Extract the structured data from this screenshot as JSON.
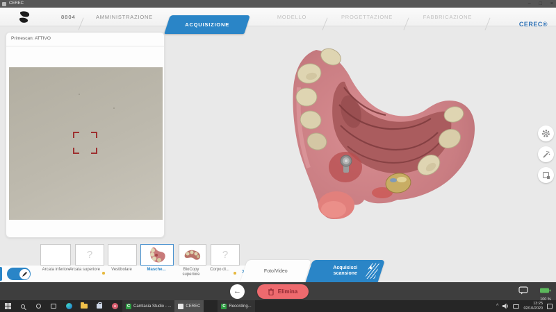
{
  "window": {
    "title": "CEREC",
    "case_id": "8804",
    "brand": "CEREC®",
    "controls": {
      "minimize": "–",
      "maximize": "□",
      "close": "×"
    }
  },
  "nav": {
    "tabs": [
      {
        "label": "AMMINISTRAZIONE",
        "state": "enabled"
      },
      {
        "label": "ACQUISIZIONE",
        "state": "active"
      },
      {
        "label": "MODELLO",
        "state": "disabled"
      },
      {
        "label": "PROGETTAZIONE",
        "state": "disabled"
      },
      {
        "label": "FABBRICAZIONE",
        "state": "disabled"
      }
    ]
  },
  "scanner_panel": {
    "status": "Primescan: ATTIVO"
  },
  "catalog": {
    "items": [
      {
        "label": "Arcata inferiore",
        "placeholder": "",
        "selected": false,
        "badge": false
      },
      {
        "label": "Arcata superiore",
        "placeholder": "?",
        "selected": false,
        "badge": true
      },
      {
        "label": "Vestibolare",
        "placeholder": "",
        "selected": false,
        "badge": false
      },
      {
        "label": "Masche...",
        "placeholder": "",
        "selected": true,
        "badge": false
      },
      {
        "label": "BioCopy superiore",
        "placeholder": "",
        "selected": false,
        "badge": false
      },
      {
        "label": "Corpo di...",
        "placeholder": "?",
        "selected": false,
        "badge": true
      }
    ]
  },
  "mode_tabs": {
    "photo_video": "Foto/Video",
    "acquire": "Acquisisci scansione"
  },
  "actions": {
    "delete": "Elimina",
    "back_arrow": "←"
  },
  "status": {
    "battery_label": "100 %"
  },
  "taskbar": {
    "tasks": {
      "camtasia": "Camtasia Studio - ...",
      "cerec": "CEREC",
      "recording": "Recording..."
    },
    "clock": {
      "time": "13:25",
      "date": "02/10/2020"
    },
    "tray_chevron": "^"
  },
  "icons": {
    "chevron_right": "›",
    "camtasia_letter": "C"
  },
  "colors": {
    "accent_blue": "#2a85c7",
    "alert_red": "#ee6a6e",
    "badge_yellow": "#e6b83e",
    "battery_green": "#5cb85c",
    "crosshair_red": "#9e3030"
  }
}
